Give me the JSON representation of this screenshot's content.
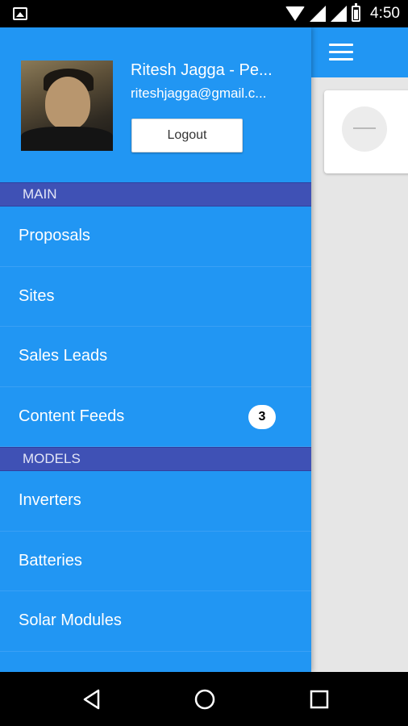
{
  "status_bar": {
    "time": "4:50",
    "icons": [
      "image-icon",
      "wifi-icon",
      "signal-icon",
      "signal-icon",
      "battery-icon"
    ]
  },
  "profile": {
    "name": "Ritesh Jagga - Pe...",
    "email": "riteshjagga@gmail.c...",
    "logout_label": "Logout"
  },
  "sections": [
    {
      "header": "MAIN",
      "items": [
        {
          "label": "Proposals"
        },
        {
          "label": "Sites"
        },
        {
          "label": "Sales Leads"
        },
        {
          "label": "Content Feeds",
          "badge": "3"
        }
      ]
    },
    {
      "header": "MODELS",
      "items": [
        {
          "label": "Inverters"
        },
        {
          "label": "Batteries"
        },
        {
          "label": "Solar Modules"
        }
      ]
    }
  ],
  "colors": {
    "primary": "#2196f3",
    "section_header": "#3f51b5",
    "background": "#e6e6e6"
  },
  "nav_bar": {
    "icons": [
      "back-icon",
      "home-icon",
      "recents-icon"
    ]
  }
}
